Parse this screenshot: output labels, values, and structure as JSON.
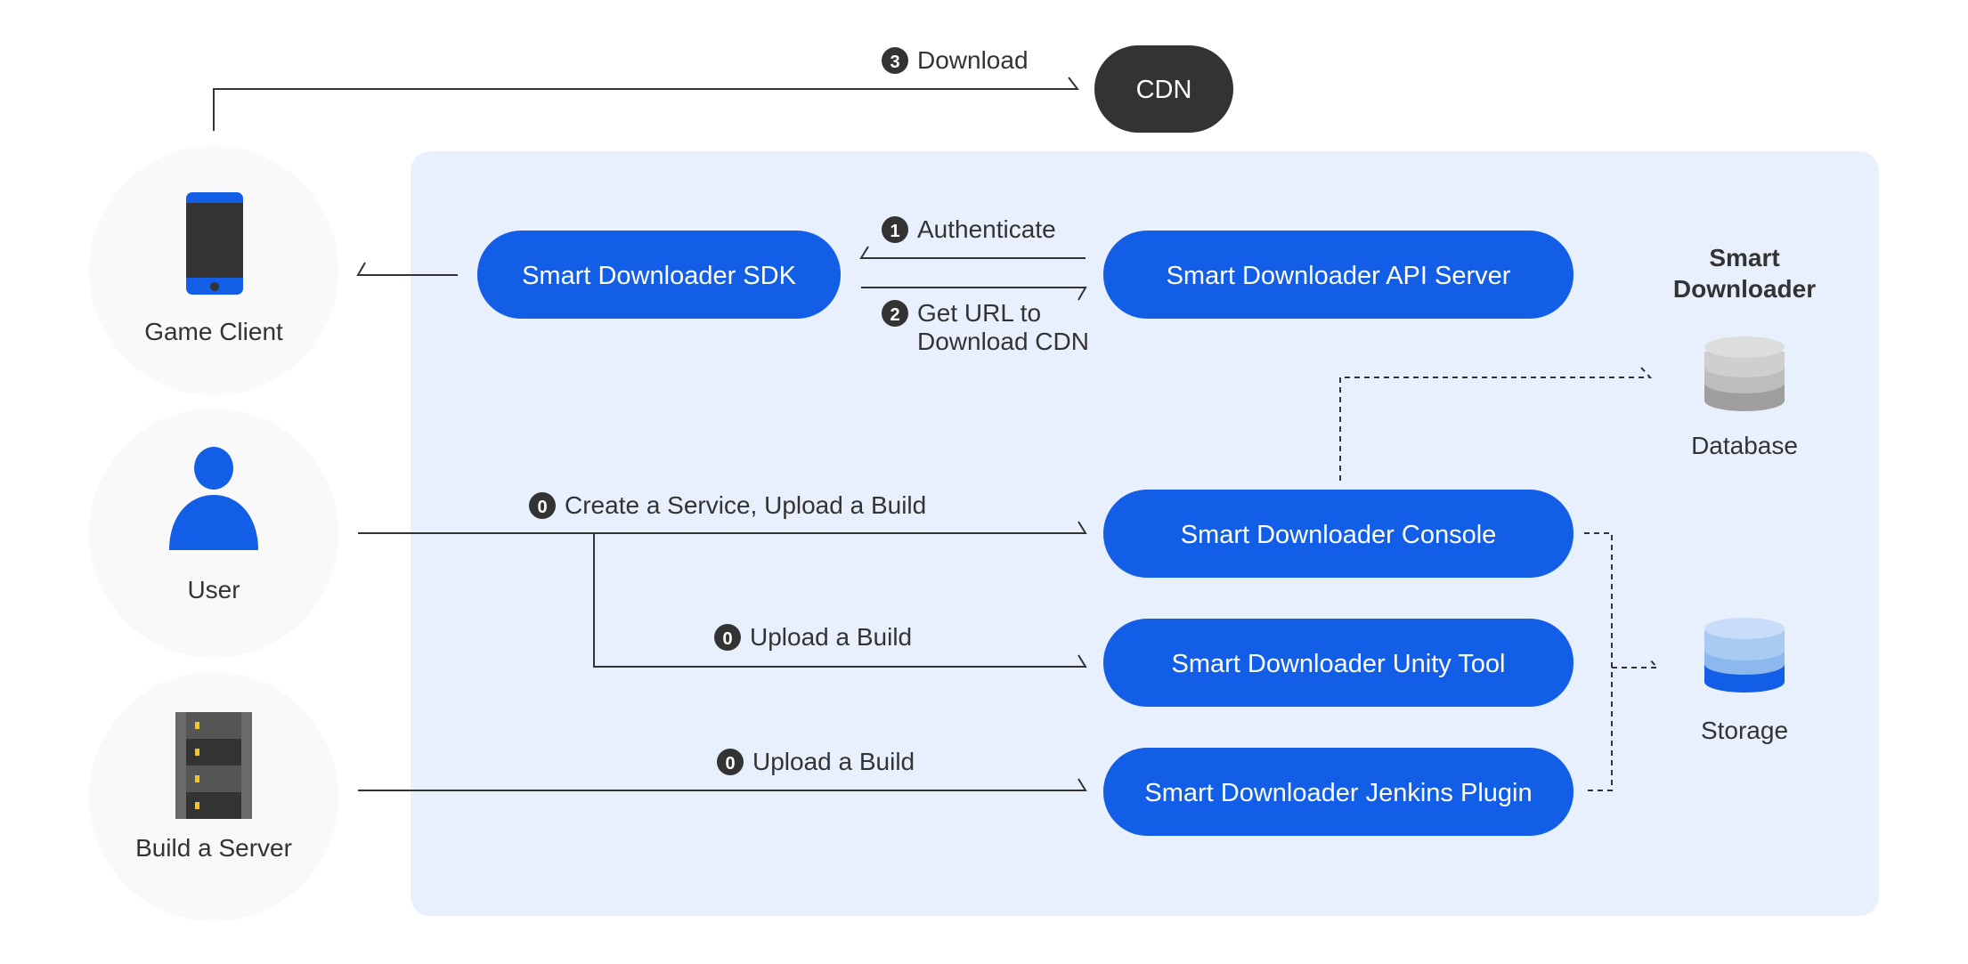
{
  "colors": {
    "accent": "#125ee6",
    "panel": "#e9f0fd",
    "dark": "#333333",
    "circle": "#f9f9f9"
  },
  "actors": [
    {
      "label": "Game Client",
      "icon": "phone-icon"
    },
    {
      "label": "User",
      "icon": "user-icon"
    },
    {
      "label": "Build a Server",
      "icon": "server-icon"
    }
  ],
  "cdn": {
    "label": "CDN"
  },
  "nodes": {
    "sdk": "Smart Downloader SDK",
    "api": "Smart Downloader API Server",
    "console": "Smart Downloader Console",
    "unity": "Smart Downloader Unity Tool",
    "jenkins": "Smart Downloader Jenkins Plugin"
  },
  "group": {
    "title_line1": "Smart",
    "title_line2": "Downloader",
    "database": "Database",
    "storage": "Storage"
  },
  "edges": {
    "download": {
      "step": "3",
      "label": "Download"
    },
    "authenticate": {
      "step": "1",
      "label": "Authenticate"
    },
    "get_url": {
      "step": "2",
      "label_line1": "Get URL to",
      "label_line2": "Download CDN"
    },
    "create_service": {
      "step": "0",
      "label": "Create a Service, Upload a Build"
    },
    "upload_unity": {
      "step": "0",
      "label": "Upload a Build"
    },
    "upload_jenkins": {
      "step": "0",
      "label": "Upload a Build"
    }
  }
}
